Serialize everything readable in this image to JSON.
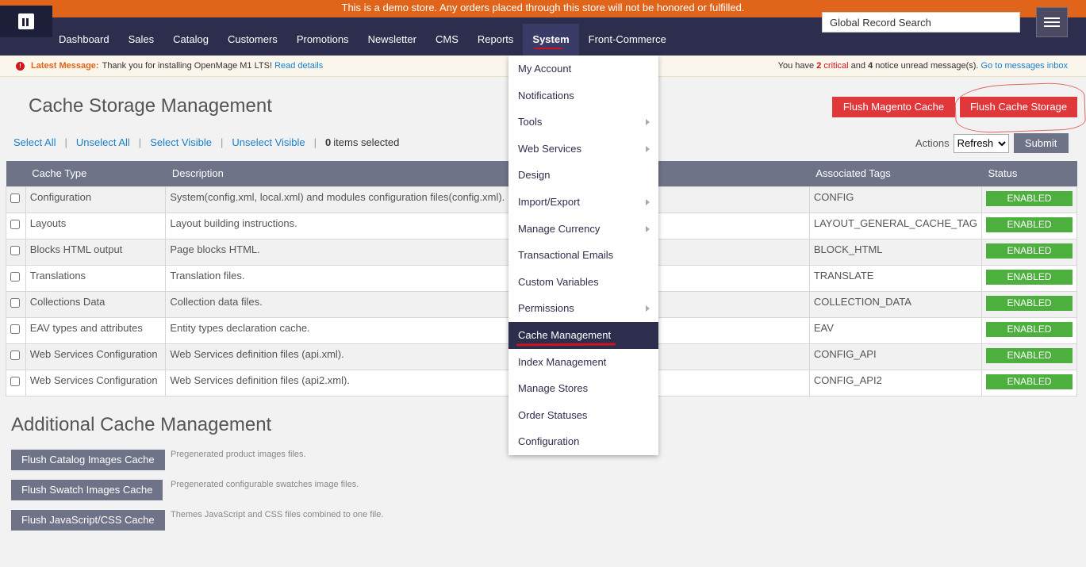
{
  "demo_notice": "This is a demo store. Any orders placed through this store will not be honored or fulfilled.",
  "nav": [
    "Dashboard",
    "Sales",
    "Catalog",
    "Customers",
    "Promotions",
    "Newsletter",
    "CMS",
    "Reports",
    "System",
    "Front-Commerce"
  ],
  "search": {
    "value": "Global Record Search"
  },
  "message": {
    "label": "Latest Message:",
    "text": "Thank you for installing OpenMage M1 LTS!",
    "link": "Read details",
    "right_prefix": "You have",
    "critical_count": "2",
    "critical_label": "critical",
    "and": "and",
    "notice_count": "4",
    "notice_label": "notice unread message(s).",
    "inbox_link": "Go to messages inbox"
  },
  "page_title": "Cache Storage Management",
  "buttons": {
    "flush_magento": "Flush Magento Cache",
    "flush_storage": "Flush Cache Storage"
  },
  "selection": {
    "select_all": "Select All",
    "unselect_all": "Unselect All",
    "select_visible": "Select Visible",
    "unselect_visible": "Unselect Visible",
    "count": "0",
    "items_selected": "items selected"
  },
  "actions": {
    "label": "Actions",
    "selected": "Refresh",
    "submit": "Submit"
  },
  "grid": {
    "headers": [
      "Cache Type",
      "Description",
      "Associated Tags",
      "Status"
    ],
    "rows": [
      {
        "type": "Configuration",
        "desc": "System(config.xml, local.xml) and modules configuration files(config.xml).",
        "tags": "CONFIG",
        "status": "ENABLED"
      },
      {
        "type": "Layouts",
        "desc": "Layout building instructions.",
        "tags": "LAYOUT_GENERAL_CACHE_TAG",
        "status": "ENABLED"
      },
      {
        "type": "Blocks HTML output",
        "desc": "Page blocks HTML.",
        "tags": "BLOCK_HTML",
        "status": "ENABLED"
      },
      {
        "type": "Translations",
        "desc": "Translation files.",
        "tags": "TRANSLATE",
        "status": "ENABLED"
      },
      {
        "type": "Collections Data",
        "desc": "Collection data files.",
        "tags": "COLLECTION_DATA",
        "status": "ENABLED"
      },
      {
        "type": "EAV types and attributes",
        "desc": "Entity types declaration cache.",
        "tags": "EAV",
        "status": "ENABLED"
      },
      {
        "type": "Web Services Configuration",
        "desc": "Web Services definition files (api.xml).",
        "tags": "CONFIG_API",
        "status": "ENABLED"
      },
      {
        "type": "Web Services Configuration",
        "desc": "Web Services definition files (api2.xml).",
        "tags": "CONFIG_API2",
        "status": "ENABLED"
      }
    ]
  },
  "additional": {
    "title": "Additional Cache Management",
    "items": [
      {
        "label": "Flush Catalog Images Cache",
        "desc": "Pregenerated product images files."
      },
      {
        "label": "Flush Swatch Images Cache",
        "desc": "Pregenerated configurable swatches image files."
      },
      {
        "label": "Flush JavaScript/CSS Cache",
        "desc": "Themes JavaScript and CSS files combined to one file."
      }
    ]
  },
  "system_menu": [
    {
      "label": "My Account",
      "sub": false
    },
    {
      "label": "Notifications",
      "sub": false
    },
    {
      "label": "Tools",
      "sub": true
    },
    {
      "label": "Web Services",
      "sub": true
    },
    {
      "label": "Design",
      "sub": false
    },
    {
      "label": "Import/Export",
      "sub": true
    },
    {
      "label": "Manage Currency",
      "sub": true
    },
    {
      "label": "Transactional Emails",
      "sub": false
    },
    {
      "label": "Custom Variables",
      "sub": false
    },
    {
      "label": "Permissions",
      "sub": true
    },
    {
      "label": "Cache Management",
      "sub": false,
      "active": true
    },
    {
      "label": "Index Management",
      "sub": false
    },
    {
      "label": "Manage Stores",
      "sub": false
    },
    {
      "label": "Order Statuses",
      "sub": false
    },
    {
      "label": "Configuration",
      "sub": false
    }
  ],
  "colors": {
    "nav_bg": "#2d2e4d",
    "demo_bar": "#e0651b",
    "red_button": "#e0373b",
    "enabled": "#4caf3e",
    "grey_button": "#6f7388"
  }
}
